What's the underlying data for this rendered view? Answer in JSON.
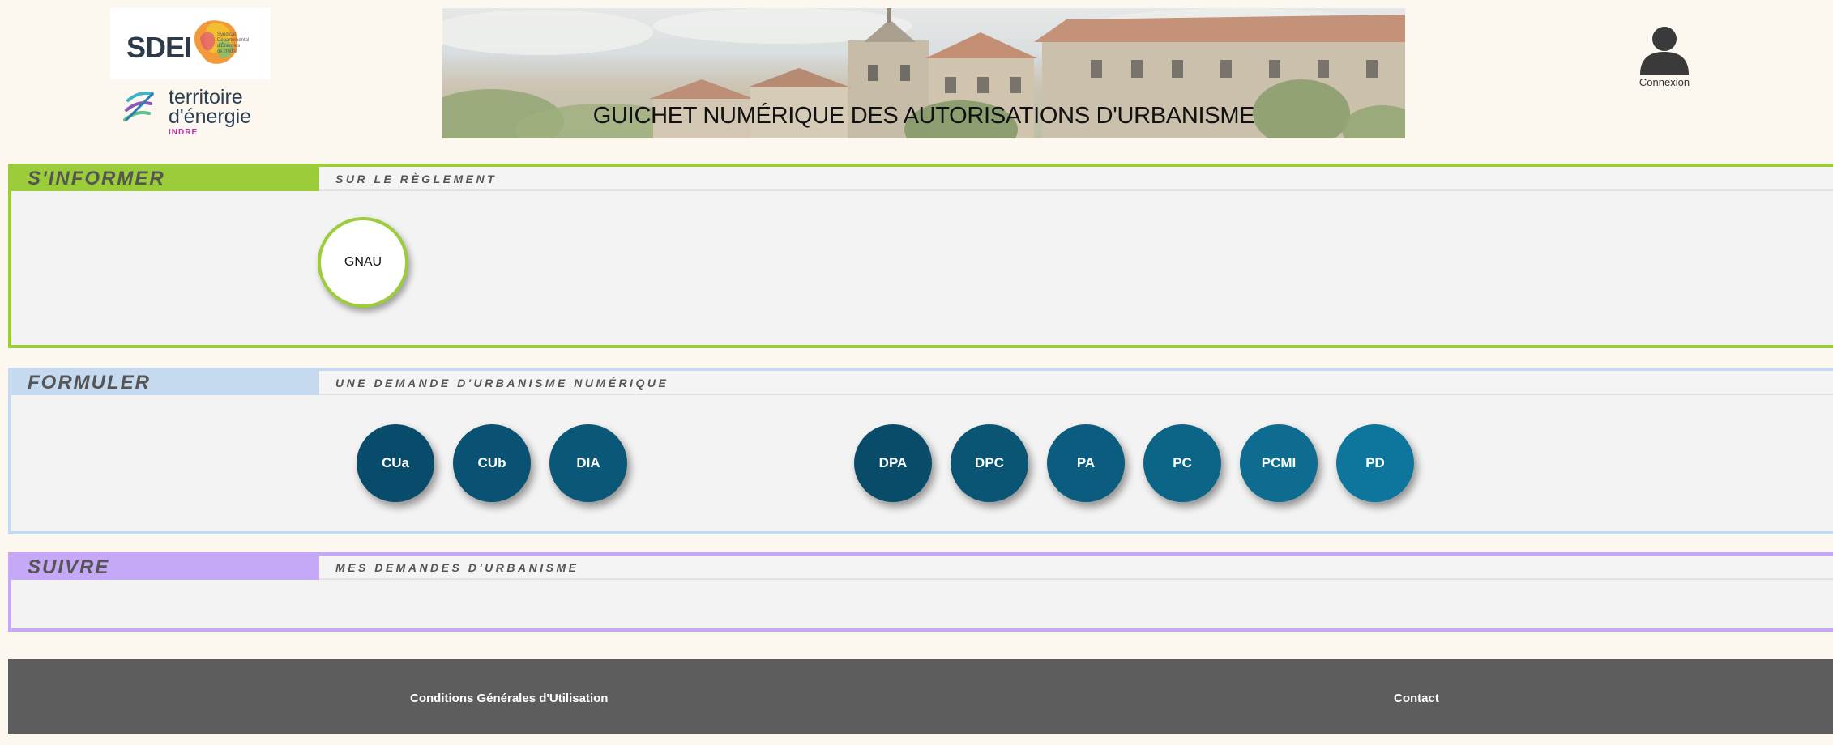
{
  "header": {
    "logo_sdei": {
      "name": "SDEI",
      "small_text": "Syndicat\nDépartemental\nd'Énergies\nde l'Indre"
    },
    "logo_territoire": {
      "line1": "territoire",
      "line2": "d'énergie",
      "line3": "INDRE"
    },
    "banner_title": "GUICHET NUMÉRIQUE DES AUTORISATIONS D'URBANISME",
    "connexion_label": "Connexion"
  },
  "sections": {
    "informer": {
      "label": "S'INFORMER",
      "subtitle": "SUR LE RÈGLEMENT",
      "button": "GNAU"
    },
    "formuler": {
      "label": "FORMULER",
      "subtitle": "UNE DEMANDE D'URBANISME NUMÉRIQUE",
      "buttons": [
        "CUa",
        "CUb",
        "DIA",
        "DPA",
        "DPC",
        "PA",
        "PC",
        "PCMI",
        "PD"
      ],
      "button_colors": [
        "#094b6a",
        "#0a5273",
        "#0b5778",
        "#094c6a",
        "#0a5474",
        "#0b5c7e",
        "#0c6487",
        "#0d6c90",
        "#0e769c"
      ]
    },
    "suivre": {
      "label": "SUIVRE",
      "subtitle": "MES DEMANDES D'URBANISME"
    }
  },
  "footer": {
    "cgu": "Conditions Générales d'Utilisation",
    "contact": "Contact"
  },
  "colors": {
    "informer": "#9bcd3a",
    "formuler": "#c5d9ef",
    "suivre": "#c5a8f6",
    "footer": "#5d5d5d",
    "page_bg": "#fdf8ef"
  }
}
